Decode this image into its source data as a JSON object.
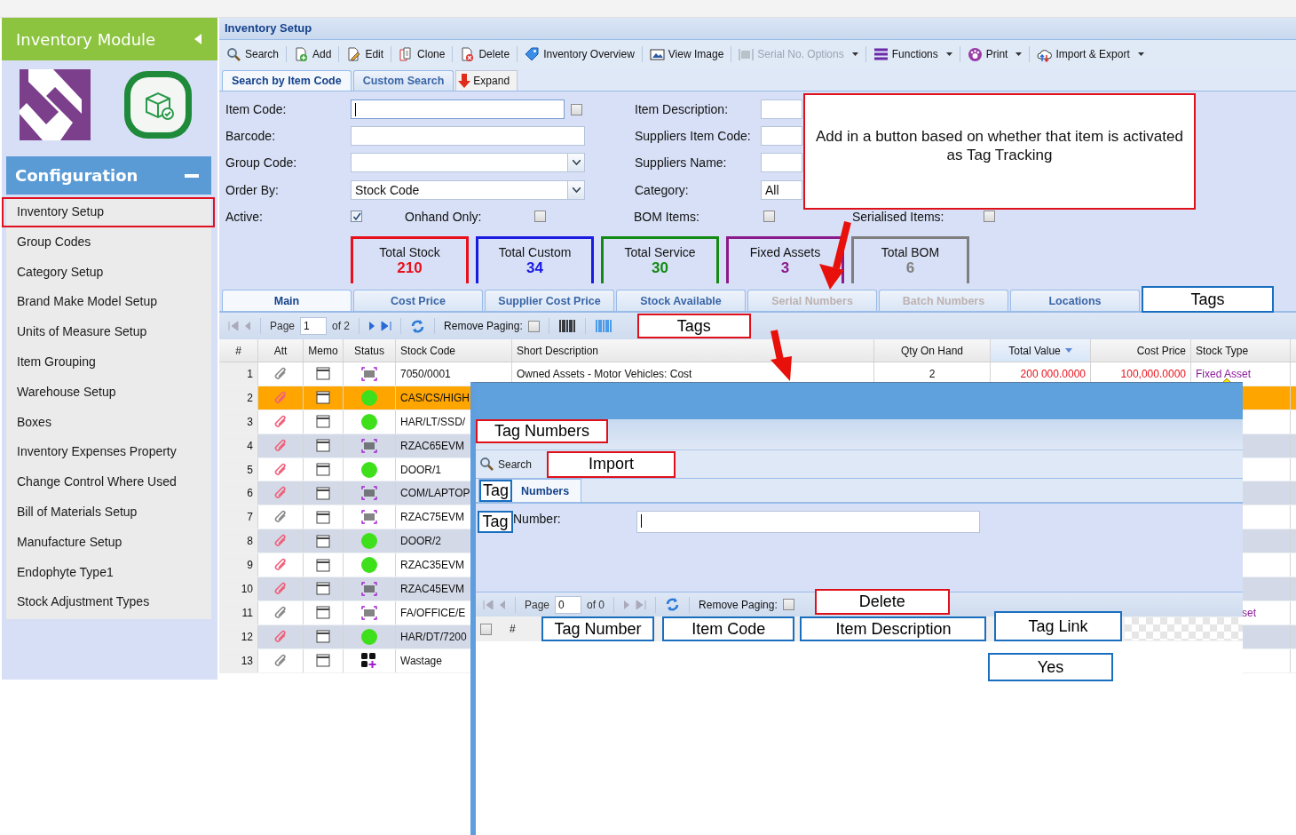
{
  "sidebar": {
    "module_title": "Inventory Module",
    "section_title": "Configuration",
    "items": [
      {
        "label": "Inventory Setup",
        "selected": true
      },
      {
        "label": "Group Codes",
        "selected": false
      },
      {
        "label": "Category Setup",
        "selected": false
      },
      {
        "label": "Brand Make Model Setup",
        "selected": false
      },
      {
        "label": "Units of Measure Setup",
        "selected": false
      },
      {
        "label": "Item Grouping",
        "selected": false
      },
      {
        "label": "Warehouse Setup",
        "selected": false
      },
      {
        "label": "Boxes",
        "selected": false
      },
      {
        "label": "Inventory Expenses Property",
        "selected": false
      },
      {
        "label": "Change Control Where Used",
        "selected": false
      },
      {
        "label": "Bill of Materials Setup",
        "selected": false
      },
      {
        "label": "Manufacture Setup",
        "selected": false
      },
      {
        "label": "Endophyte Type1",
        "selected": false
      },
      {
        "label": "Stock Adjustment Types",
        "selected": false
      }
    ]
  },
  "main": {
    "title": "Inventory Setup",
    "toolbar": [
      {
        "label": "Search",
        "kind": "search",
        "disabled": false,
        "dropdown": false
      },
      {
        "label": "Add",
        "kind": "add",
        "disabled": false,
        "dropdown": false
      },
      {
        "label": "Edit",
        "kind": "edit",
        "disabled": false,
        "dropdown": false
      },
      {
        "label": "Clone",
        "kind": "clone",
        "disabled": false,
        "dropdown": false
      },
      {
        "label": "Delete",
        "kind": "delete",
        "disabled": false,
        "dropdown": false
      },
      {
        "label": "Inventory Overview",
        "kind": "tag",
        "disabled": false,
        "dropdown": false
      },
      {
        "label": "View Image",
        "kind": "image",
        "disabled": false,
        "dropdown": false
      },
      {
        "label": "Serial No. Options",
        "kind": "barcode",
        "disabled": true,
        "dropdown": true
      },
      {
        "label": "Functions",
        "kind": "bars",
        "disabled": false,
        "dropdown": true
      },
      {
        "label": "Print",
        "kind": "print",
        "disabled": false,
        "dropdown": true
      },
      {
        "label": "Import & Export",
        "kind": "cloud",
        "disabled": false,
        "dropdown": true
      }
    ],
    "search_tabs": [
      {
        "label": "Search by Item Code",
        "selected": true
      },
      {
        "label": "Custom Search",
        "selected": false
      }
    ],
    "expand_button": "Expand",
    "form": {
      "left": [
        {
          "label": "Item Code:",
          "kind": "text",
          "focused": true,
          "checkbox": {
            "checked": false
          }
        },
        {
          "label": "Barcode:",
          "kind": "text",
          "focused": false
        },
        {
          "label": "Group Code:",
          "kind": "combo",
          "focused": false
        },
        {
          "label": "Order By:",
          "kind": "combo",
          "value": "Stock Code",
          "focused": false
        }
      ],
      "right": [
        {
          "label": "Item Description:"
        },
        {
          "label": "Suppliers Item Code:"
        },
        {
          "label": "Suppliers Name:"
        },
        {
          "label": "Category:",
          "value": "All"
        }
      ],
      "flags": [
        {
          "label": "Active:",
          "checked": true
        },
        {
          "label": "Onhand Only:",
          "checked": false
        },
        {
          "label": "BOM Items:",
          "checked": false
        },
        {
          "label": "Serialised Items:",
          "checked": false
        }
      ]
    },
    "summary_cards": [
      {
        "label": "Total Stock",
        "value": "210",
        "color": "#e8101a"
      },
      {
        "label": "Total Custom",
        "value": "34",
        "color": "#1a1ae0"
      },
      {
        "label": "Total Service",
        "value": "30",
        "color": "#138a13"
      },
      {
        "label": "Fixed Assets",
        "value": "3",
        "color": "#8b1a8b"
      },
      {
        "label": "Total BOM",
        "value": "6",
        "color": "#7f7f7f"
      }
    ],
    "callout": "Add in a button based on whether that item is activated as Tag Tracking",
    "grid_tabs": [
      {
        "label": "Main",
        "kind": "tab",
        "selected": true,
        "disabled": false
      },
      {
        "label": "Cost Price",
        "kind": "tab",
        "selected": false,
        "disabled": false
      },
      {
        "label": "Supplier Cost Price",
        "kind": "tab",
        "selected": false,
        "disabled": false
      },
      {
        "label": "Stock Available",
        "kind": "tab",
        "selected": false,
        "disabled": false
      },
      {
        "label": "Serial Numbers",
        "kind": "tab",
        "selected": false,
        "disabled": true
      },
      {
        "label": "Batch Numbers",
        "kind": "tab",
        "selected": false,
        "disabled": true
      },
      {
        "label": "Locations",
        "kind": "tab",
        "selected": false,
        "disabled": false
      },
      {
        "label": "Tags",
        "kind": "annotation"
      }
    ],
    "pager": {
      "page_label": "Page",
      "page": "1",
      "of": "of 2",
      "remove_paging": "Remove Paging:",
      "remove_paging_checked": false,
      "note": "Tags"
    },
    "columns": [
      {
        "label": "#",
        "sorted": false
      },
      {
        "label": "Att",
        "sorted": false
      },
      {
        "label": "Memo",
        "sorted": false
      },
      {
        "label": "Status",
        "sorted": false
      },
      {
        "label": "Stock Code",
        "sorted": false
      },
      {
        "label": "Short Description",
        "sorted": false
      },
      {
        "label": "Qty On Hand",
        "sorted": false
      },
      {
        "label": "Total Value",
        "sorted": true
      },
      {
        "label": "Cost Price",
        "sorted": false
      },
      {
        "label": "Stock Type",
        "sorted": false
      }
    ],
    "rows": [
      {
        "num": "1",
        "attached": false,
        "kind": "barcode",
        "stock_code": "7050/0001",
        "description": "Owned Assets - Motor Vehicles: Cost",
        "qty": "2",
        "total_value": "200 000.0000",
        "cost_price": "100,000.0000",
        "stock_type": "Fixed Asset",
        "selected": false
      },
      {
        "num": "2",
        "attached": true,
        "kind": "active",
        "stock_code": "CAS/CS/HIGH",
        "selected": true
      },
      {
        "num": "3",
        "attached": true,
        "kind": "active",
        "stock_code": "HAR/LT/SSD/",
        "selected": false
      },
      {
        "num": "4",
        "attached": true,
        "kind": "barcode",
        "stock_code": "RZAC65EVM",
        "selected": false
      },
      {
        "num": "5",
        "attached": true,
        "kind": "active",
        "stock_code": "DOOR/1",
        "selected": false
      },
      {
        "num": "6",
        "attached": true,
        "kind": "barcode",
        "stock_code": "COM/LAPTOP",
        "selected": false
      },
      {
        "num": "7",
        "attached": false,
        "kind": "barcode",
        "stock_code": "RZAC75EVM",
        "selected": false
      },
      {
        "num": "8",
        "attached": true,
        "kind": "active",
        "stock_code": "DOOR/2",
        "selected": false
      },
      {
        "num": "9",
        "attached": true,
        "kind": "active",
        "stock_code": "RZAC35EVM",
        "selected": false
      },
      {
        "num": "10",
        "attached": true,
        "kind": "barcode",
        "stock_code": "RZAC45EVM",
        "selected": false
      },
      {
        "num": "11",
        "attached": false,
        "kind": "barcode",
        "stock_code": "FA/OFFICE/E",
        "stock_type_fragment": "set",
        "selected": false
      },
      {
        "num": "12",
        "attached": true,
        "kind": "active",
        "stock_code": "HAR/DT/7200",
        "selected": false
      },
      {
        "num": "13",
        "attached": false,
        "kind": "bundle",
        "stock_code": "Wastage",
        "selected": false
      }
    ]
  },
  "popup": {
    "panel_title": "Tag Numbers",
    "search": "Search",
    "import_button": "Import",
    "tab": {
      "note": "Tag",
      "label": "Numbers"
    },
    "field": {
      "note": "Tag",
      "label": "Number:",
      "focused": true
    },
    "pager": {
      "page_label": "Page",
      "page": "0",
      "of": "of 0",
      "remove_paging": "Remove Paging:",
      "remove_paging_checked": false,
      "delete_button": "Delete"
    },
    "columns": [
      "#",
      "Tag Number",
      "Item Code",
      "Item Description",
      "Tag Link"
    ],
    "example_row": {
      "tag_link": "Yes"
    }
  }
}
